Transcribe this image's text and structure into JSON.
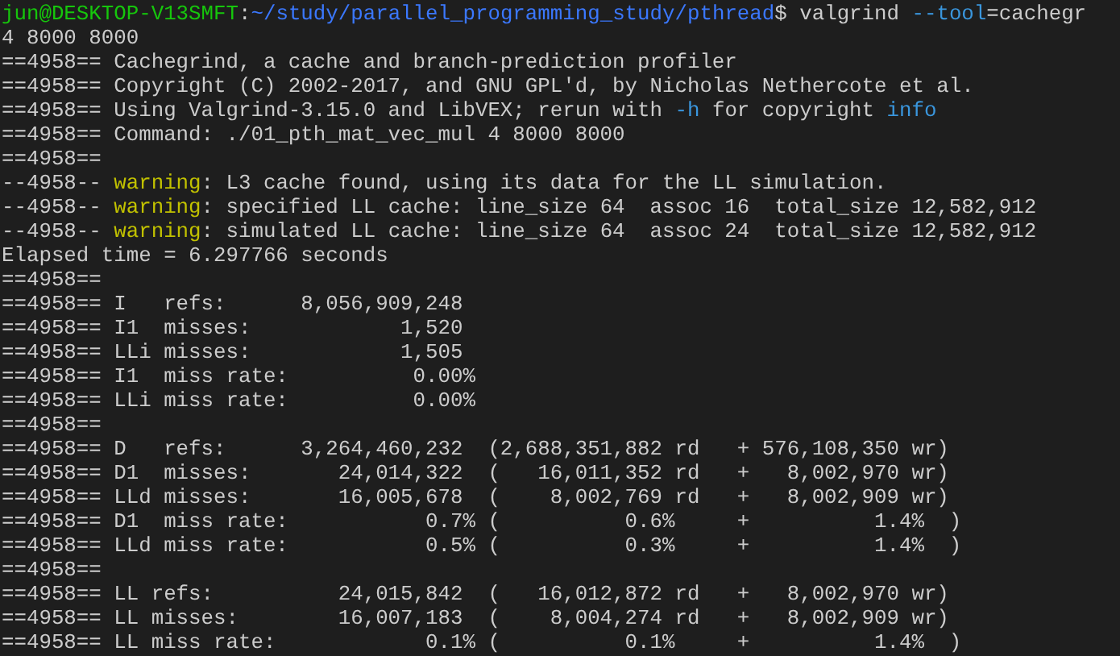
{
  "terminal": {
    "lines": [
      {
        "segments": [
          {
            "kind": "prompt",
            "text": "jun@DESKTOP-V13SMFT"
          },
          {
            "kind": "text",
            "text": ":"
          },
          {
            "kind": "path",
            "text": "~/study/parallel_programming_study/pthread"
          },
          {
            "kind": "text",
            "text": "$ valgrind "
          },
          {
            "kind": "highlight",
            "text": "--tool"
          },
          {
            "kind": "text",
            "text": "=cachegr"
          }
        ]
      },
      {
        "segments": [
          {
            "kind": "text",
            "text": "4 8000 8000"
          }
        ]
      },
      {
        "segments": [
          {
            "kind": "text",
            "text": "==4958== Cachegrind, a cache and branch-prediction profiler"
          }
        ]
      },
      {
        "segments": [
          {
            "kind": "text",
            "text": "==4958== Copyright (C) 2002-2017, and GNU GPL'd, by Nicholas Nethercote et al."
          }
        ]
      },
      {
        "segments": [
          {
            "kind": "text",
            "text": "==4958== Using Valgrind-3.15.0 and LibVEX; rerun with "
          },
          {
            "kind": "highlight",
            "text": "-h"
          },
          {
            "kind": "text",
            "text": " for copyright "
          },
          {
            "kind": "highlight",
            "text": "info"
          }
        ]
      },
      {
        "segments": [
          {
            "kind": "text",
            "text": "==4958== Command: ./01_pth_mat_vec_mul 4 8000 8000"
          }
        ]
      },
      {
        "segments": [
          {
            "kind": "text",
            "text": "==4958=="
          }
        ]
      },
      {
        "segments": [
          {
            "kind": "text",
            "text": "--4958-- "
          },
          {
            "kind": "warning",
            "text": "warning"
          },
          {
            "kind": "text",
            "text": ": L3 cache found, using its data for the LL simulation."
          }
        ]
      },
      {
        "segments": [
          {
            "kind": "text",
            "text": "--4958-- "
          },
          {
            "kind": "warning",
            "text": "warning"
          },
          {
            "kind": "text",
            "text": ": specified LL cache: line_size 64  assoc 16  total_size 12,582,912"
          }
        ]
      },
      {
        "segments": [
          {
            "kind": "text",
            "text": "--4958-- "
          },
          {
            "kind": "warning",
            "text": "warning"
          },
          {
            "kind": "text",
            "text": ": simulated LL cache: line_size 64  assoc 24  total_size 12,582,912"
          }
        ]
      },
      {
        "segments": [
          {
            "kind": "text",
            "text": "Elapsed time = 6.297766 seconds"
          }
        ]
      },
      {
        "segments": [
          {
            "kind": "text",
            "text": "==4958=="
          }
        ]
      },
      {
        "segments": [
          {
            "kind": "text",
            "text": "==4958== I   refs:      8,056,909,248"
          }
        ]
      },
      {
        "segments": [
          {
            "kind": "text",
            "text": "==4958== I1  misses:            1,520"
          }
        ]
      },
      {
        "segments": [
          {
            "kind": "text",
            "text": "==4958== LLi misses:            1,505"
          }
        ]
      },
      {
        "segments": [
          {
            "kind": "text",
            "text": "==4958== I1  miss rate:          0.00%"
          }
        ]
      },
      {
        "segments": [
          {
            "kind": "text",
            "text": "==4958== LLi miss rate:          0.00%"
          }
        ]
      },
      {
        "segments": [
          {
            "kind": "text",
            "text": "==4958=="
          }
        ]
      },
      {
        "segments": [
          {
            "kind": "text",
            "text": "==4958== D   refs:      3,264,460,232  (2,688,351,882 rd   + 576,108,350 wr)"
          }
        ]
      },
      {
        "segments": [
          {
            "kind": "text",
            "text": "==4958== D1  misses:       24,014,322  (   16,011,352 rd   +   8,002,970 wr)"
          }
        ]
      },
      {
        "segments": [
          {
            "kind": "text",
            "text": "==4958== LLd misses:       16,005,678  (    8,002,769 rd   +   8,002,909 wr)"
          }
        ]
      },
      {
        "segments": [
          {
            "kind": "text",
            "text": "==4958== D1  miss rate:           0.7% (          0.6%     +          1.4%  )"
          }
        ]
      },
      {
        "segments": [
          {
            "kind": "text",
            "text": "==4958== LLd miss rate:           0.5% (          0.3%     +          1.4%  )"
          }
        ]
      },
      {
        "segments": [
          {
            "kind": "text",
            "text": "==4958=="
          }
        ]
      },
      {
        "segments": [
          {
            "kind": "text",
            "text": "==4958== LL refs:          24,015,842  (   16,012,872 rd   +   8,002,970 wr)"
          }
        ]
      },
      {
        "segments": [
          {
            "kind": "text",
            "text": "==4958== LL misses:        16,007,183  (    8,004,274 rd   +   8,002,909 wr)"
          }
        ]
      },
      {
        "segments": [
          {
            "kind": "text",
            "text": "==4958== LL miss rate:            0.1% (          0.1%     +          1.4%  )"
          }
        ]
      }
    ]
  }
}
